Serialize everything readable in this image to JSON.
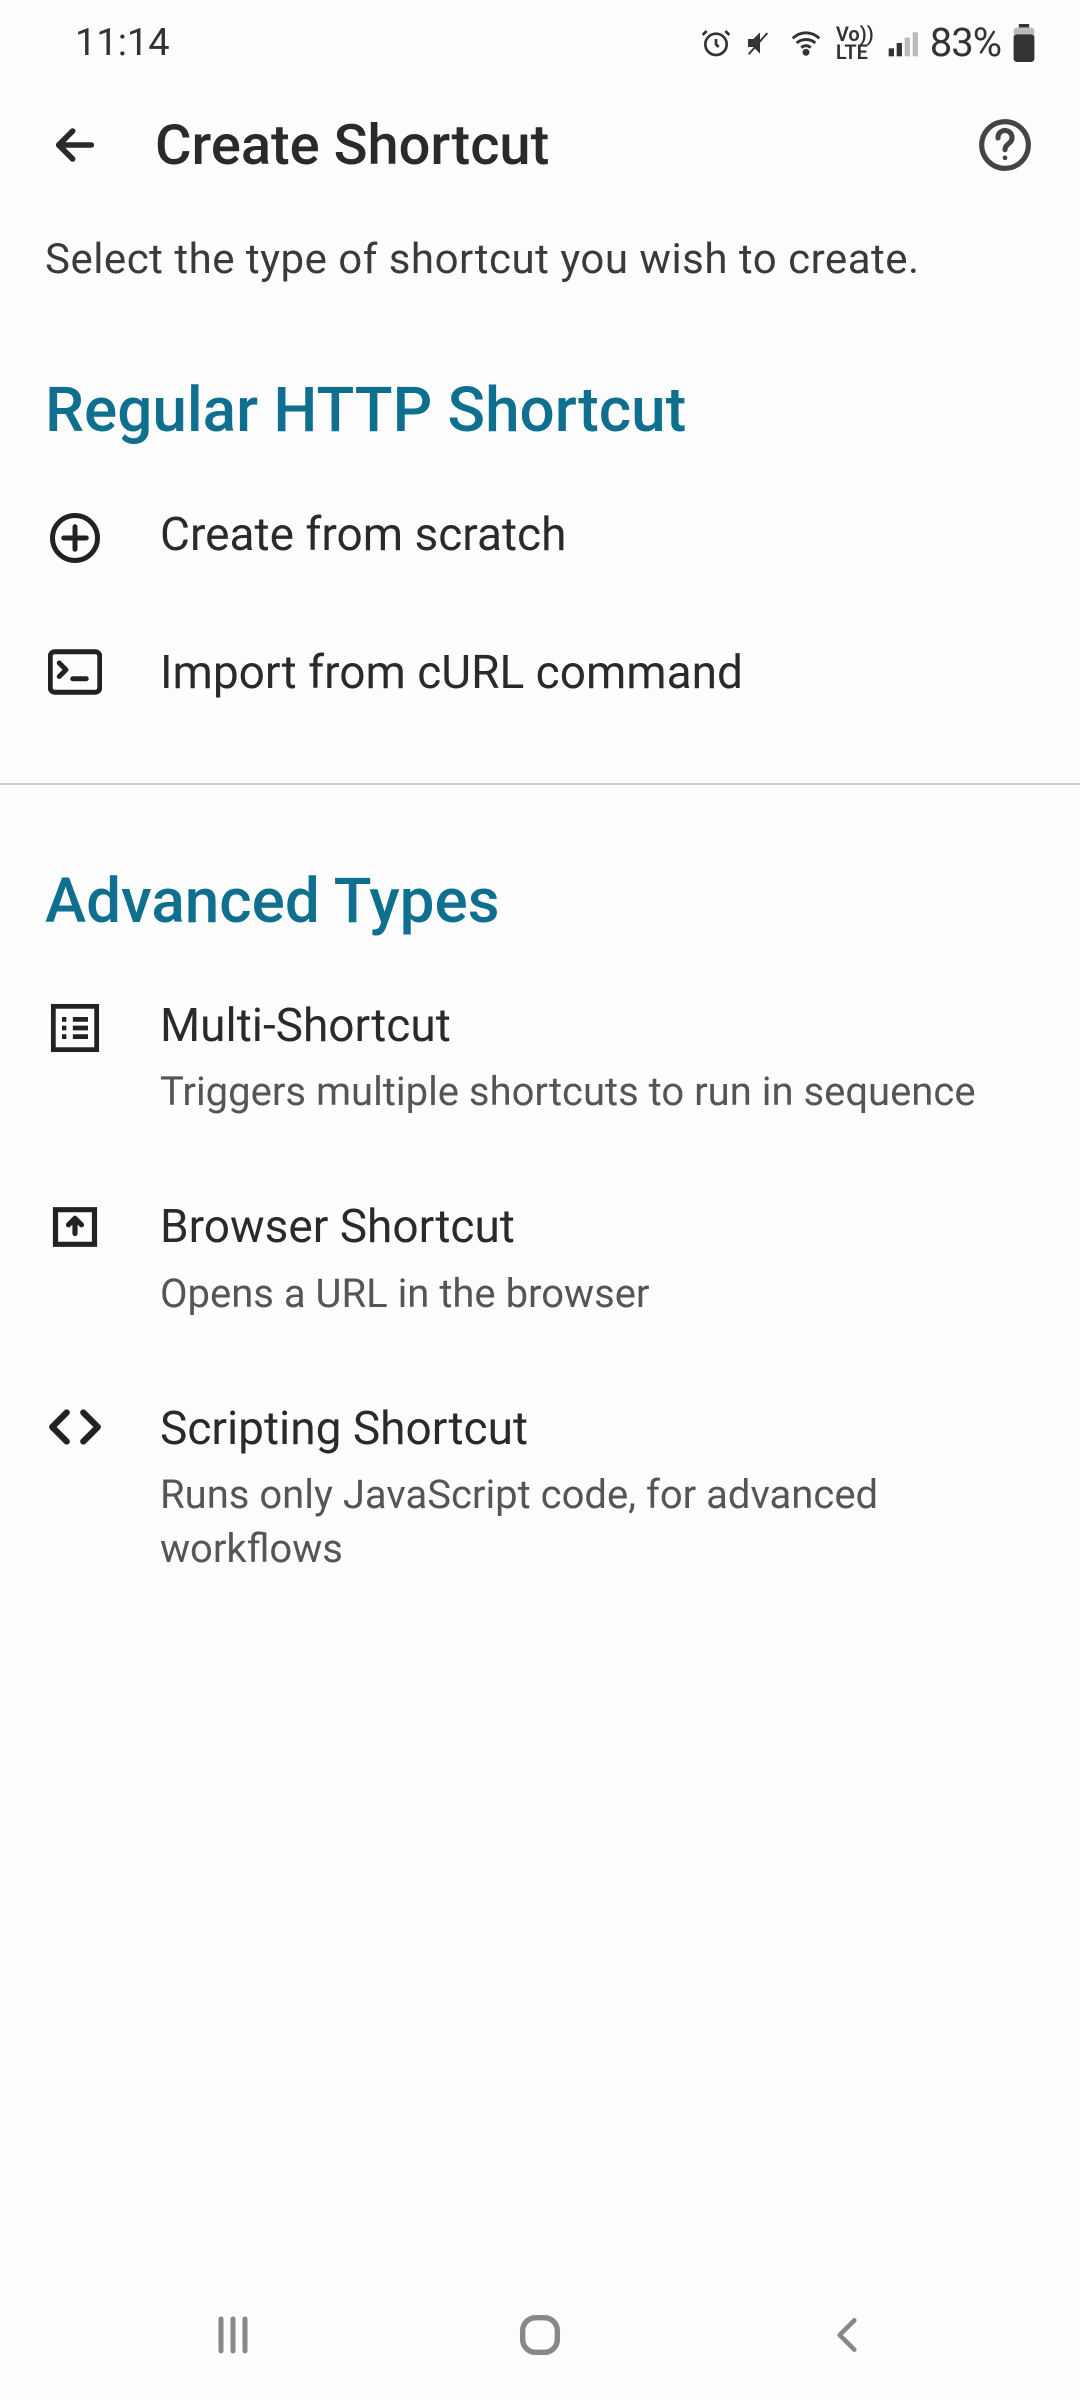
{
  "status": {
    "time": "11:14",
    "battery": "83%"
  },
  "header": {
    "title": "Create Shortcut"
  },
  "subtitle": "Select the type of shortcut you wish to create.",
  "sections": [
    {
      "title": "Regular HTTP Shortcut",
      "items": [
        {
          "title": "Create from scratch",
          "desc": ""
        },
        {
          "title": "Import from cURL command",
          "desc": ""
        }
      ]
    },
    {
      "title": "Advanced Types",
      "items": [
        {
          "title": "Multi-Shortcut",
          "desc": "Triggers multiple shortcuts to run in sequence"
        },
        {
          "title": "Browser Shortcut",
          "desc": "Opens a URL in the browser"
        },
        {
          "title": "Scripting Shortcut",
          "desc": "Runs only JavaScript code, for advanced workflows"
        }
      ]
    }
  ]
}
